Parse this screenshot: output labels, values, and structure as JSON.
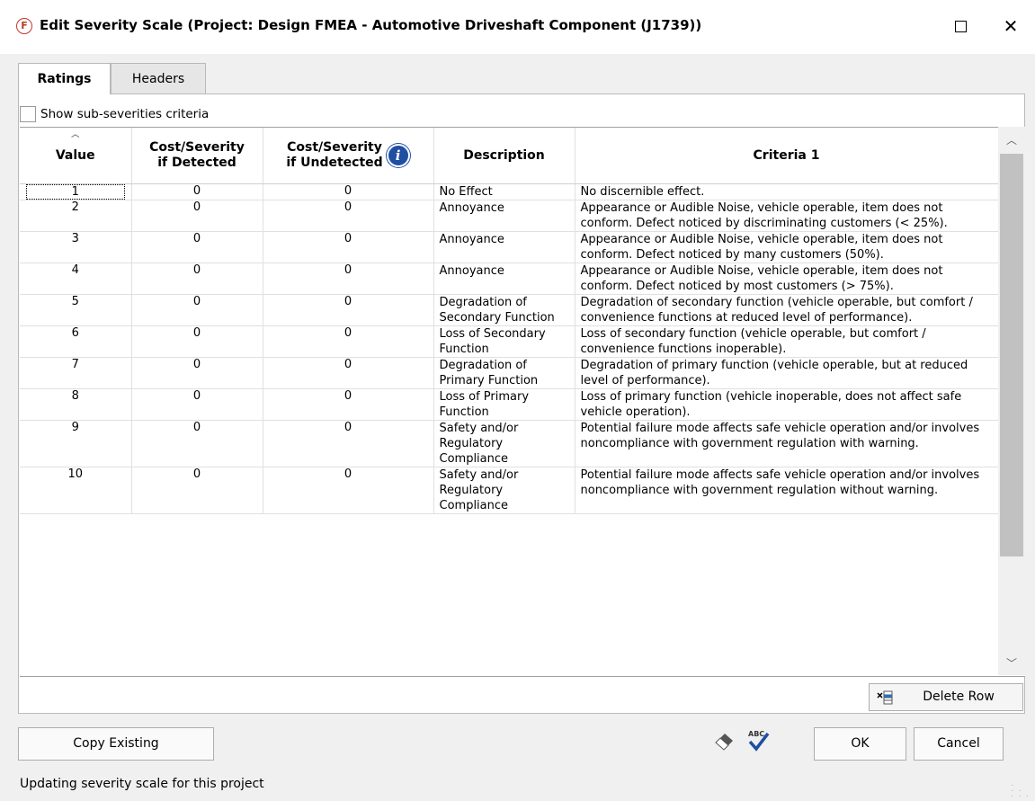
{
  "window": {
    "title": "Edit Severity Scale (Project: Design FMEA - Automotive Driveshaft Component (J1739))",
    "app_icon_letter": "F"
  },
  "tabs": [
    {
      "label": "Ratings",
      "active": true
    },
    {
      "label": "Headers",
      "active": false
    }
  ],
  "show_subseverities": {
    "label": "Show sub-severities criteria",
    "checked": false
  },
  "columns": {
    "value": "Value",
    "cost_detected_1": "Cost/Severity",
    "cost_detected_2": "if Detected",
    "cost_undetected_1": "Cost/Severity",
    "cost_undetected_2": "if Undetected",
    "description": "Description",
    "criteria": "Criteria 1"
  },
  "rows": [
    {
      "value": "1",
      "cost_detected": "0",
      "cost_undetected": "0",
      "description": "No Effect",
      "criteria": "No discernible effect."
    },
    {
      "value": "2",
      "cost_detected": "0",
      "cost_undetected": "0",
      "description": "Annoyance",
      "criteria": "Appearance or Audible Noise, vehicle operable, item does not conform.  Defect noticed by discriminating customers (< 25%)."
    },
    {
      "value": "3",
      "cost_detected": "0",
      "cost_undetected": "0",
      "description": "Annoyance",
      "criteria": "Appearance or Audible Noise, vehicle operable, item does not conform.  Defect noticed by many customers (50%)."
    },
    {
      "value": "4",
      "cost_detected": "0",
      "cost_undetected": "0",
      "description": "Annoyance",
      "criteria": "Appearance or Audible Noise, vehicle operable, item does not conform.  Defect noticed by most customers (> 75%)."
    },
    {
      "value": "5",
      "cost_detected": "0",
      "cost_undetected": "0",
      "description": "Degradation of Secondary Function",
      "criteria": "Degradation of secondary function (vehicle operable, but comfort / convenience functions at reduced level of performance)."
    },
    {
      "value": "6",
      "cost_detected": "0",
      "cost_undetected": "0",
      "description": "Loss of Secondary Function",
      "criteria": "Loss of secondary function (vehicle operable, but comfort / convenience functions inoperable)."
    },
    {
      "value": "7",
      "cost_detected": "0",
      "cost_undetected": "0",
      "description": "Degradation of Primary Function",
      "criteria": "Degradation of primary function (vehicle operable, but at reduced level of performance)."
    },
    {
      "value": "8",
      "cost_detected": "0",
      "cost_undetected": "0",
      "description": "Loss of Primary Function",
      "criteria": "Loss of primary function (vehicle inoperable, does not affect safe vehicle operation)."
    },
    {
      "value": "9",
      "cost_detected": "0",
      "cost_undetected": "0",
      "description": "Safety and/or Regulatory Compliance",
      "criteria": "Potential failure mode affects safe vehicle operation and/or involves noncompliance with government regulation with warning."
    },
    {
      "value": "10",
      "cost_detected": "0",
      "cost_undetected": "0",
      "description": "Safety and/or Regulatory Compliance",
      "criteria": "Potential failure mode affects safe vehicle operation and/or involves noncompliance with government regulation without warning."
    }
  ],
  "buttons": {
    "delete_row": "Delete Row",
    "copy_existing": "Copy Existing",
    "ok": "OK",
    "cancel": "Cancel"
  },
  "status": "Updating severity scale for this project",
  "colors": {
    "info_icon": "#1e4fa3",
    "app_icon": "#c0392b",
    "spellcheck": "#1e4fa3"
  }
}
